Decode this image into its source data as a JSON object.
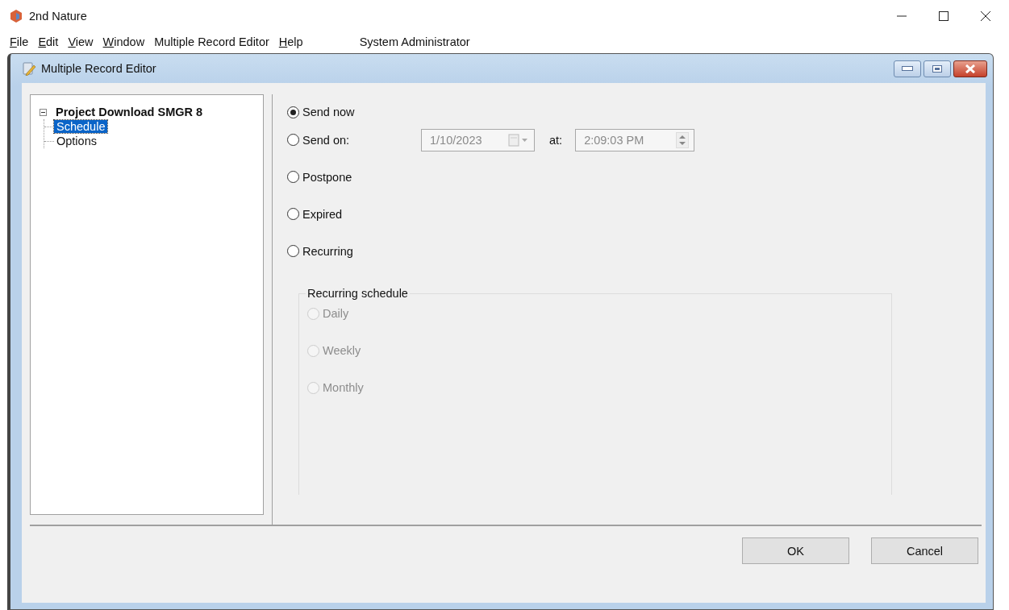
{
  "window": {
    "title": "2nd Nature"
  },
  "menu": [
    {
      "label": "File",
      "mnemonic": true
    },
    {
      "label": "Edit",
      "mnemonic": true
    },
    {
      "label": "View",
      "mnemonic": true
    },
    {
      "label": "Window",
      "mnemonic": true
    },
    {
      "label": "Multiple Record Editor",
      "mnemonic": false
    },
    {
      "label": "Help",
      "mnemonic": true
    }
  ],
  "user": "System Administrator",
  "editor": {
    "title": "Multiple Record Editor",
    "tree": [
      {
        "label": "Project Download SMGR 8",
        "expanded": true,
        "selected": false,
        "children": [
          {
            "label": "Schedule",
            "selected": true
          },
          {
            "label": "Options",
            "selected": false
          }
        ]
      }
    ],
    "schedule_options": [
      {
        "label": "Send now",
        "selected": true
      },
      {
        "label": "Send on:",
        "selected": false
      },
      {
        "label": "Postpone",
        "selected": false
      },
      {
        "label": "Expired",
        "selected": false
      },
      {
        "label": "Recurring",
        "selected": false
      }
    ],
    "send_on": {
      "date": "1/10/2023",
      "at_label": "at:",
      "time": "2:09:03 PM",
      "disabled": true
    },
    "recurring": {
      "title": "Recurring schedule",
      "disabled": true,
      "options": [
        {
          "label": "Daily",
          "selected": false
        },
        {
          "label": "Weekly",
          "selected": false
        },
        {
          "label": "Monthly",
          "selected": false
        }
      ]
    },
    "buttons": [
      "OK",
      "Cancel"
    ]
  }
}
